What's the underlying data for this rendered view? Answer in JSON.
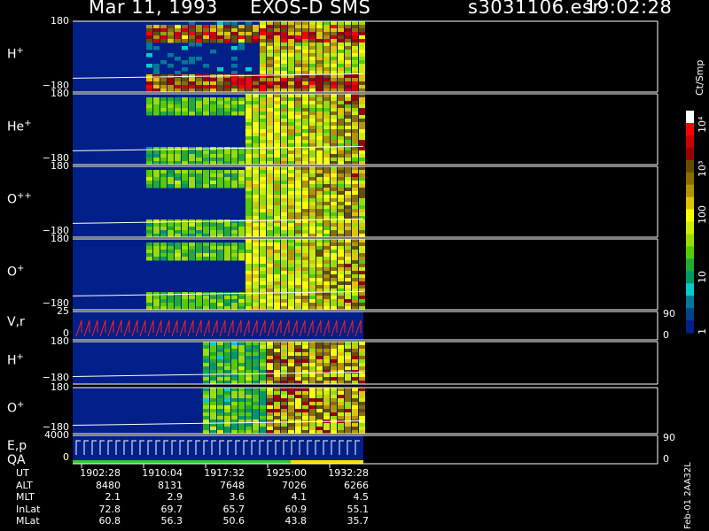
{
  "header": {
    "date_title": "Mar 11, 1993",
    "instrument": "EXOS-D SMS",
    "file_name": "s3031106.esr",
    "time": "19:02:28"
  },
  "panels": [
    {
      "label": "H",
      "sup": "+",
      "top_tick": "180",
      "bottom_tick": "−180"
    },
    {
      "label": "He",
      "sup": "+",
      "top_tick": "180",
      "bottom_tick": "−180"
    },
    {
      "label": "O",
      "sup": "++",
      "top_tick": "180",
      "bottom_tick": "−180"
    },
    {
      "label": "O",
      "sup": "+",
      "top_tick": "180",
      "bottom_tick": "−180"
    },
    {
      "label": "V,r",
      "sup": "",
      "top_tick": "25",
      "bottom_tick": "0",
      "right_top": "90",
      "right_bottom": "0"
    },
    {
      "label": "H",
      "sup": "+",
      "top_tick": "180",
      "bottom_tick": "−180"
    },
    {
      "label": "O",
      "sup": "+",
      "top_tick": "180",
      "bottom_tick": "−180"
    },
    {
      "label": "E,p",
      "sup": "",
      "top_tick": "4000",
      "bottom_tick": "0",
      "right_top": "90",
      "right_bottom": "0",
      "sublabel": "QA"
    }
  ],
  "colorbar": {
    "unit": "Ct/Smp",
    "tick_labels": [
      "10⁴",
      "10³",
      "100",
      "10",
      "1"
    ],
    "colors": [
      "#ffffff",
      "#ff0000",
      "#cc0000",
      "#990000",
      "#664d00",
      "#8c6e00",
      "#b39400",
      "#e0c400",
      "#ffff00",
      "#ccee00",
      "#99dd00",
      "#55cc00",
      "#22aa33",
      "#009966",
      "#00cccc",
      "#007799",
      "#004488",
      "#001f88"
    ]
  },
  "orbit_table": {
    "rows": [
      {
        "name": "UT",
        "values": [
          "1902:28",
          "1910:04",
          "1917:32",
          "1925:00",
          "1932:28"
        ]
      },
      {
        "name": "ALT",
        "values": [
          "8480",
          "8131",
          "7648",
          "7026",
          "6266"
        ]
      },
      {
        "name": "MLT",
        "values": [
          "2.1",
          "2.9",
          "3.6",
          "4.1",
          "4.5"
        ]
      },
      {
        "name": "InLat",
        "values": [
          "72.8",
          "69.7",
          "65.7",
          "60.9",
          "55.1"
        ]
      },
      {
        "name": "MLat",
        "values": [
          "60.8",
          "56.3",
          "50.6",
          "43.8",
          "35.7"
        ]
      }
    ]
  },
  "footer_code": "Feb-01 2AA32L",
  "chart_data": {
    "type": "heatmap",
    "title": "Mar 11, 1993 EXOS-D SMS",
    "x_tick_labels": [
      "1902:28",
      "1910:04",
      "1917:32",
      "1925:00",
      "1932:28"
    ],
    "quality_bar_colors": [
      "#33cc33",
      "#33cc33",
      "#33cc33",
      "#ffdd00"
    ],
    "colorscale_unit": "Ct/Smp",
    "colorscale_ticks": [
      "1",
      "10",
      "100",
      "10³",
      "10⁴"
    ]
  }
}
